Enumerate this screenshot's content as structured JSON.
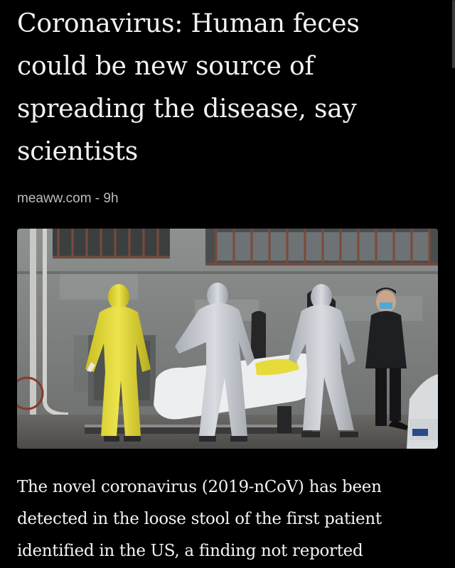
{
  "article": {
    "headline": "Coronavirus: Human feces could be new source of spreading the disease, say scientists",
    "source": "meaww.com",
    "separator": " - ",
    "age": "9h",
    "image_description": "Workers in protective suits carrying a body bag on a street",
    "body": "The novel coronavirus (2019-nCoV) has been detected in the loose stool of the first patient identified in the US, a finding not reported"
  },
  "colors": {
    "background": "#000000",
    "headline": "#f2f2f2",
    "meta": "#bdbdbd",
    "hazmat_yellow": "#e0d63a",
    "hazmat_white": "#c9ccd3"
  }
}
